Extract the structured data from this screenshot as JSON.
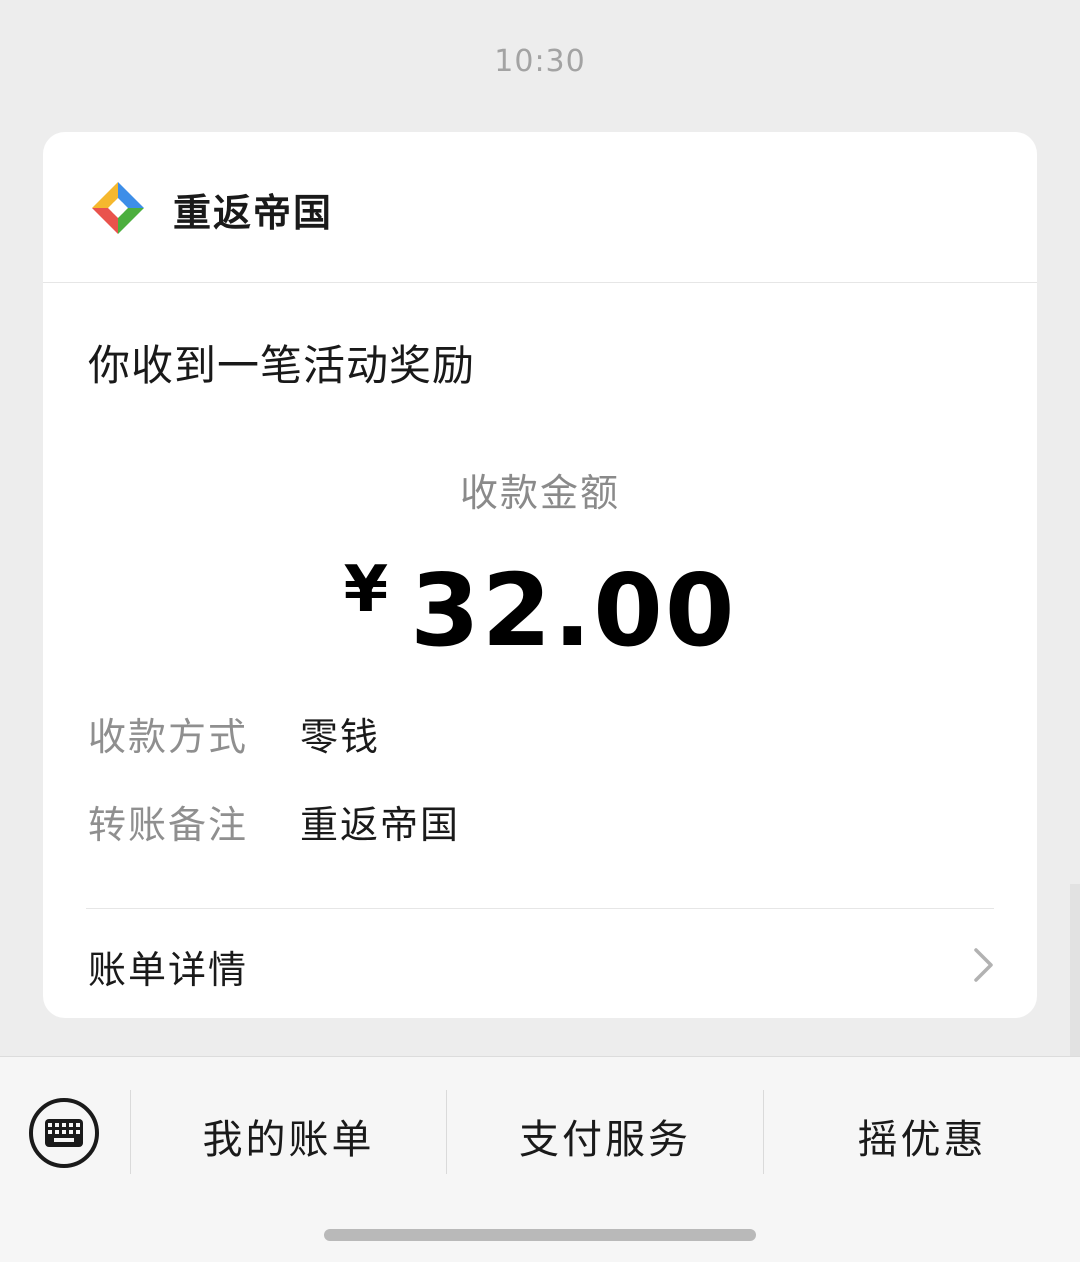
{
  "timestamp": "10:30",
  "card": {
    "brand": {
      "name": "重返帝国",
      "logo_icon": "colorful-diamond-icon",
      "logo_colors": [
        "#f5b82e",
        "#4caf3e",
        "#3d8ee8",
        "#e9534c"
      ]
    },
    "title": "你收到一笔活动奖励",
    "amount_label": "收款金额",
    "currency_symbol": "¥",
    "amount_value": "32.00",
    "details": [
      {
        "key": "收款方式",
        "value": "零钱"
      },
      {
        "key": "转账备注",
        "value": "重返帝国"
      }
    ],
    "bill_detail_label": "账单详情",
    "bill_detail_icon": "chevron-right-icon"
  },
  "bottom_bar": {
    "keyboard_icon": "keyboard-icon",
    "menu": [
      "我的账单",
      "支付服务",
      "摇优惠"
    ]
  }
}
